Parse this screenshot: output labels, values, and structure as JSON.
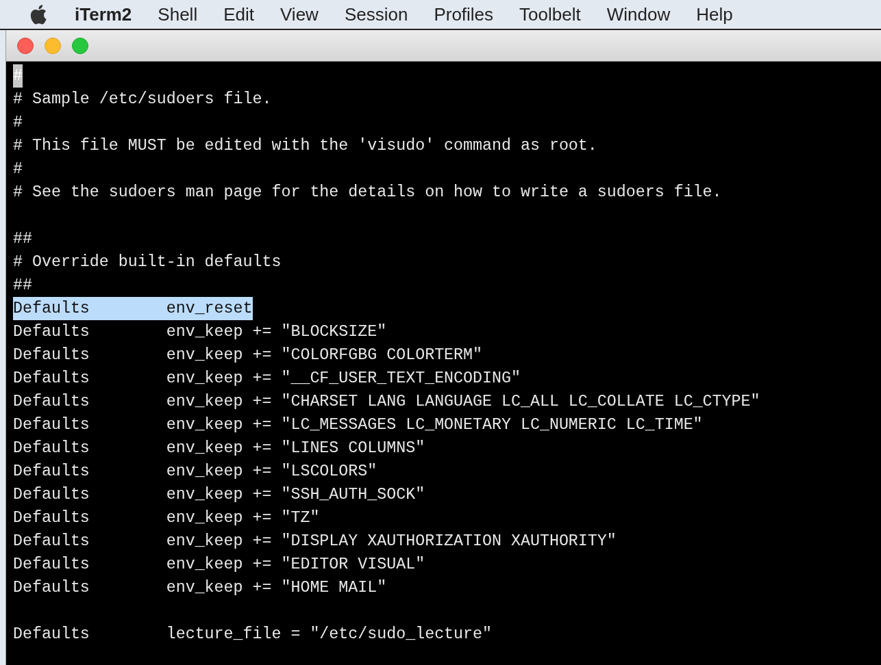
{
  "menu_bar": {
    "app_name": "iTerm2",
    "items": [
      "Shell",
      "Edit",
      "View",
      "Session",
      "Profiles",
      "Toolbelt",
      "Window",
      "Help"
    ]
  },
  "terminal": {
    "lines": [
      {
        "kind": "text",
        "text": "#",
        "cursor": true,
        "selected": false
      },
      {
        "kind": "text",
        "text": "# Sample /etc/sudoers file.",
        "cursor": false,
        "selected": false
      },
      {
        "kind": "text",
        "text": "#",
        "cursor": false,
        "selected": false
      },
      {
        "kind": "text",
        "text": "# This file MUST be edited with the 'visudo' command as root.",
        "cursor": false,
        "selected": false
      },
      {
        "kind": "text",
        "text": "#",
        "cursor": false,
        "selected": false
      },
      {
        "kind": "text",
        "text": "# See the sudoers man page for the details on how to write a sudoers file.",
        "cursor": false,
        "selected": false
      },
      {
        "kind": "blank"
      },
      {
        "kind": "text",
        "text": "##",
        "cursor": false,
        "selected": false
      },
      {
        "kind": "text",
        "text": "# Override built-in defaults",
        "cursor": false,
        "selected": false
      },
      {
        "kind": "text",
        "text": "##",
        "cursor": false,
        "selected": false
      },
      {
        "kind": "text",
        "text": "Defaults        env_reset",
        "cursor": false,
        "selected": true
      },
      {
        "kind": "text",
        "text": "Defaults        env_keep += \"BLOCKSIZE\"",
        "cursor": false,
        "selected": false
      },
      {
        "kind": "text",
        "text": "Defaults        env_keep += \"COLORFGBG COLORTERM\"",
        "cursor": false,
        "selected": false
      },
      {
        "kind": "text",
        "text": "Defaults        env_keep += \"__CF_USER_TEXT_ENCODING\"",
        "cursor": false,
        "selected": false
      },
      {
        "kind": "text",
        "text": "Defaults        env_keep += \"CHARSET LANG LANGUAGE LC_ALL LC_COLLATE LC_CTYPE\"",
        "cursor": false,
        "selected": false
      },
      {
        "kind": "text",
        "text": "Defaults        env_keep += \"LC_MESSAGES LC_MONETARY LC_NUMERIC LC_TIME\"",
        "cursor": false,
        "selected": false
      },
      {
        "kind": "text",
        "text": "Defaults        env_keep += \"LINES COLUMNS\"",
        "cursor": false,
        "selected": false
      },
      {
        "kind": "text",
        "text": "Defaults        env_keep += \"LSCOLORS\"",
        "cursor": false,
        "selected": false
      },
      {
        "kind": "text",
        "text": "Defaults        env_keep += \"SSH_AUTH_SOCK\"",
        "cursor": false,
        "selected": false
      },
      {
        "kind": "text",
        "text": "Defaults        env_keep += \"TZ\"",
        "cursor": false,
        "selected": false
      },
      {
        "kind": "text",
        "text": "Defaults        env_keep += \"DISPLAY XAUTHORIZATION XAUTHORITY\"",
        "cursor": false,
        "selected": false
      },
      {
        "kind": "text",
        "text": "Defaults        env_keep += \"EDITOR VISUAL\"",
        "cursor": false,
        "selected": false
      },
      {
        "kind": "text",
        "text": "Defaults        env_keep += \"HOME MAIL\"",
        "cursor": false,
        "selected": false
      },
      {
        "kind": "blank"
      },
      {
        "kind": "text",
        "text": "Defaults        lecture_file = \"/etc/sudo_lecture\"",
        "cursor": false,
        "selected": false
      }
    ]
  }
}
